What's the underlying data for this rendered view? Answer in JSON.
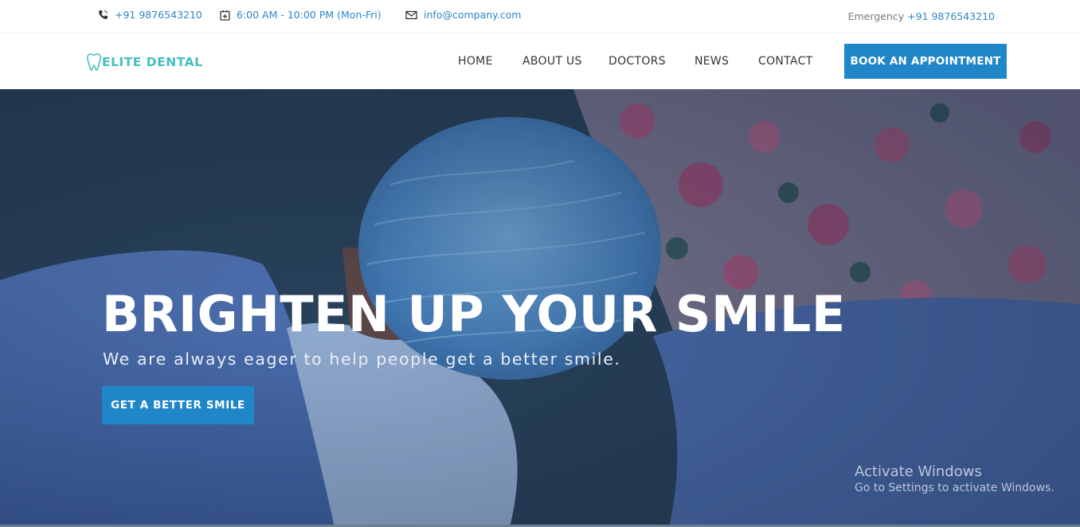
{
  "topbar": {
    "phone": "+91 9876543210",
    "hours": "6:00 AM - 10:00 PM (Mon-Fri)",
    "email": "info@company.com",
    "emergency_label": "Emergency",
    "emergency_phone": "+91 9876543210"
  },
  "brand": {
    "name": "ELITE DENTAL",
    "accent": "#44bfc0"
  },
  "nav": {
    "items": [
      "HOME",
      "ABOUT US",
      "DOCTORS",
      "NEWS",
      "CONTACT"
    ],
    "cta": "BOOK AN APPOINTMENT",
    "cta_color": "#1f86c8"
  },
  "hero": {
    "title": "BRIGHTEN UP YOUR SMILE",
    "subtitle": "We are always eager to help people get a better smile.",
    "button": "GET A BETTER SMILE"
  },
  "watermark": {
    "line1": "Activate Windows",
    "line2": "Go to Settings to activate Windows."
  },
  "icons": {
    "phone": "phone-icon",
    "calendar": "calendar-icon",
    "mail": "mail-icon",
    "logo": "tooth-icon"
  }
}
